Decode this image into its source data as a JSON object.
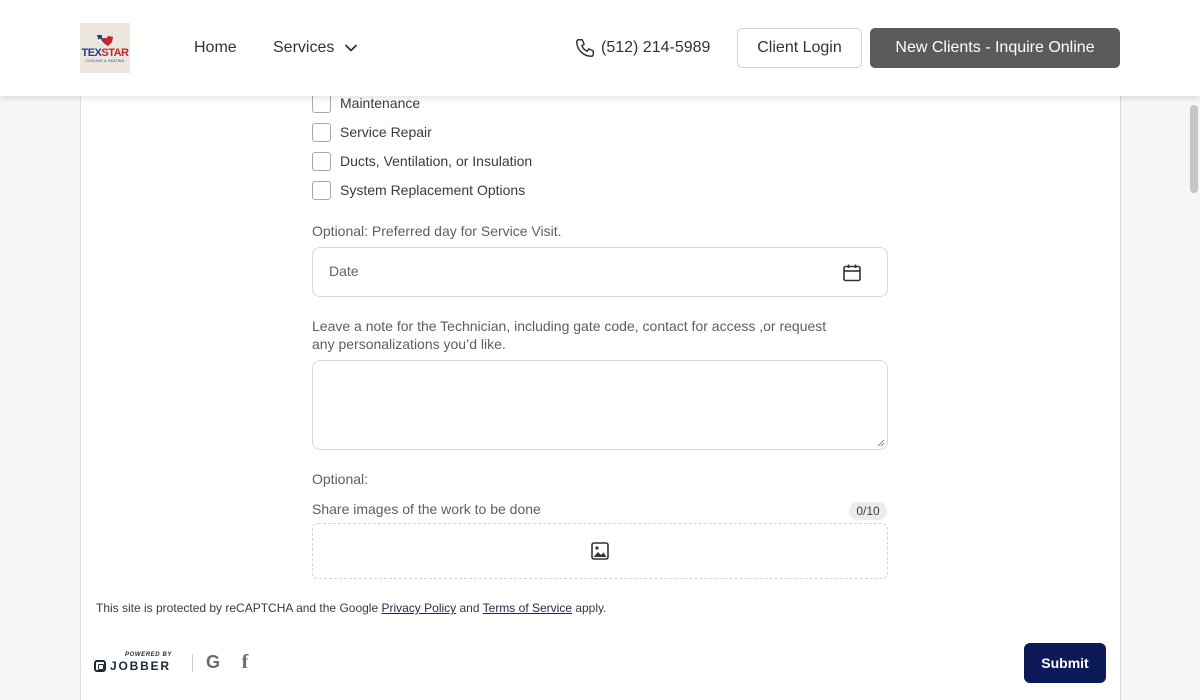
{
  "header": {
    "logo": {
      "brand": "TEXSTAR",
      "brand_tex": "TEX",
      "brand_star": "STAR",
      "tagline": "COOLING & HEATING"
    },
    "nav": {
      "home": "Home",
      "services": "Services"
    },
    "phone": "(512) 214-5989",
    "client_login": "Client Login",
    "new_clients": "New Clients - Inquire Online"
  },
  "form": {
    "service_options": [
      {
        "label": "Maintenance",
        "checked": false
      },
      {
        "label": "Service Repair",
        "checked": false
      },
      {
        "label": "Ducts, Ventilation, or Insulation",
        "checked": false
      },
      {
        "label": "System Replacement Options",
        "checked": false
      }
    ],
    "date_label": "Optional: Preferred day for Service Visit.",
    "date_placeholder": "Date",
    "note_label_line1": "Leave a note for the Technician, including gate code, contact for access ,or request",
    "note_label_line2": "any personalizations you’d like.",
    "note_value": "",
    "optional_label": "Optional:",
    "images_label": "Share images of the work to be done",
    "images_count": "0/10"
  },
  "footer": {
    "recaptcha_prefix": "This site is protected by reCAPTCHA and the Google ",
    "privacy_link": "Privacy Policy",
    "and": " and ",
    "terms_link": "Terms of Service",
    "suffix": " apply.",
    "jobber_powered": "POWERED BY",
    "jobber_word": "JOBBER",
    "social": {
      "google": "G",
      "facebook": "f"
    },
    "submit": "Submit"
  },
  "colors": {
    "primary_button": "#5b5b5b",
    "submit_button": "#0c1a57",
    "brand_red": "#c4262e",
    "brand_blue": "#1d3f8f"
  },
  "icons": [
    "phone-icon",
    "chevron-down-icon",
    "calendar-icon",
    "image-icon",
    "google-icon",
    "facebook-icon"
  ]
}
